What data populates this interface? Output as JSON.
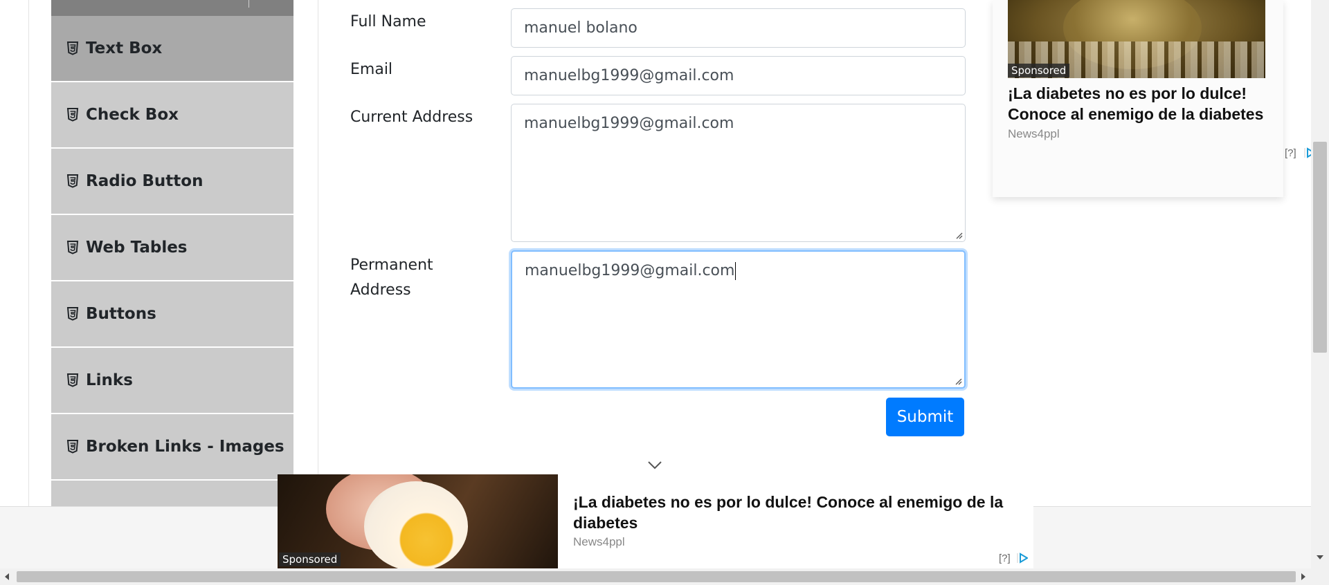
{
  "sidebar": {
    "items": [
      {
        "label": "Text Box",
        "icon": "html5-icon"
      },
      {
        "label": "Check Box",
        "icon": "html5-icon"
      },
      {
        "label": "Radio Button",
        "icon": "html5-icon"
      },
      {
        "label": "Web Tables",
        "icon": "html5-icon"
      },
      {
        "label": "Buttons",
        "icon": "html5-icon"
      },
      {
        "label": "Links",
        "icon": "html5-icon"
      },
      {
        "label": "Broken Links - Images",
        "icon": "html5-icon"
      }
    ],
    "active_item": "Text Box"
  },
  "form": {
    "full_name": {
      "label": "Full Name",
      "value": "manuel bolano"
    },
    "email": {
      "label": "Email",
      "value": "manuelbg1999@gmail.com"
    },
    "current_address": {
      "label": "Current Address",
      "value": "manuelbg1999@gmail.com"
    },
    "permanent_address": {
      "label_line1": "Permanent",
      "label_line2": "Address",
      "value": "manuelbg1999@gmail.com"
    },
    "submit_label": "Submit"
  },
  "ad_top": {
    "sponsored": "Sponsored",
    "title": "¡La diabetes no es por lo dulce! Conoce al enemigo de la diabetes",
    "source": "News4ppl",
    "help": "[?]"
  },
  "ad_bottom": {
    "sponsored": "Sponsored",
    "title": "¡La diabetes no es por lo dulce! Conoce al enemigo de la diabetes",
    "source": "News4ppl",
    "help": "[?]"
  },
  "colors": {
    "accent": "#007bff",
    "sidebar_active": "#a9a9a9",
    "sidebar_item": "#cbcbcb",
    "focus_ring": "#80bdff"
  }
}
